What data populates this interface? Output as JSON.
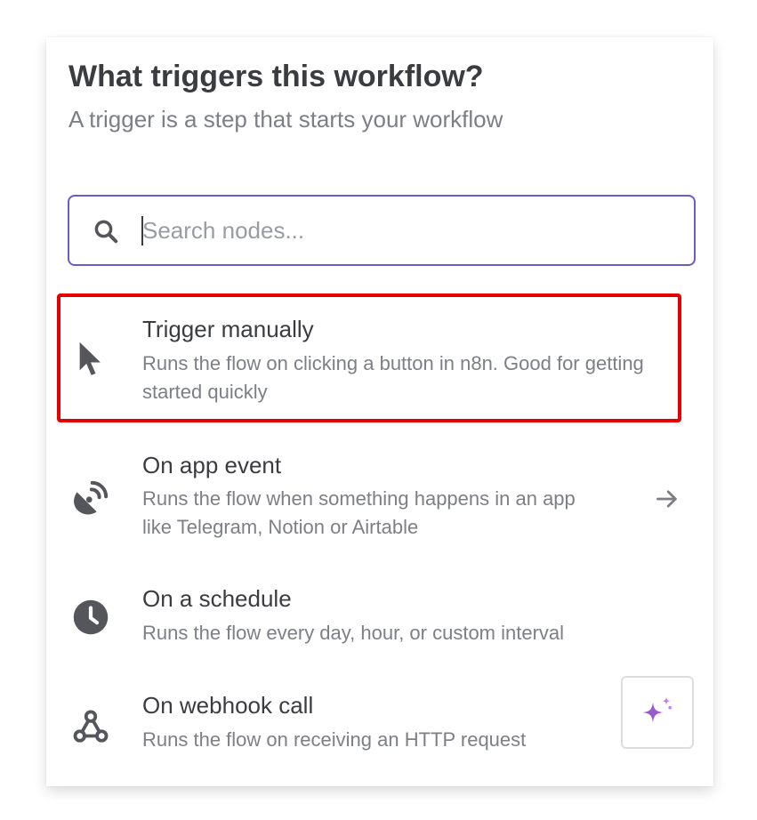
{
  "header": {
    "title": "What triggers this workflow?",
    "subtitle": "A trigger is a step that starts your workflow"
  },
  "search": {
    "placeholder": "Search nodes...",
    "value": "",
    "icon": "search-icon"
  },
  "triggers": [
    {
      "name": "Trigger manually",
      "description": "Runs the flow on clicking a button in n8n. Good for getting started quickly",
      "icon": "mouse-pointer-icon",
      "highlighted": true
    },
    {
      "name": "On app event",
      "description": "Runs the flow when something happens in an app like Telegram, Notion or Airtable",
      "icon": "satellite-dish-icon",
      "has_arrow": true
    },
    {
      "name": "On a schedule",
      "description": "Runs the flow every day, hour, or custom interval",
      "icon": "clock-icon"
    },
    {
      "name": "On webhook call",
      "description": "Runs the flow on receiving an HTTP request",
      "icon": "webhook-icon"
    }
  ],
  "ai_button": {
    "icon": "sparkles-icon"
  },
  "colors": {
    "accent": "#6b5cc9",
    "highlight": "#e60000",
    "text_primary": "#3b3c40",
    "text_secondary": "#7d7f86",
    "icon": "#55565c",
    "sparkle": "#9b59d0"
  }
}
